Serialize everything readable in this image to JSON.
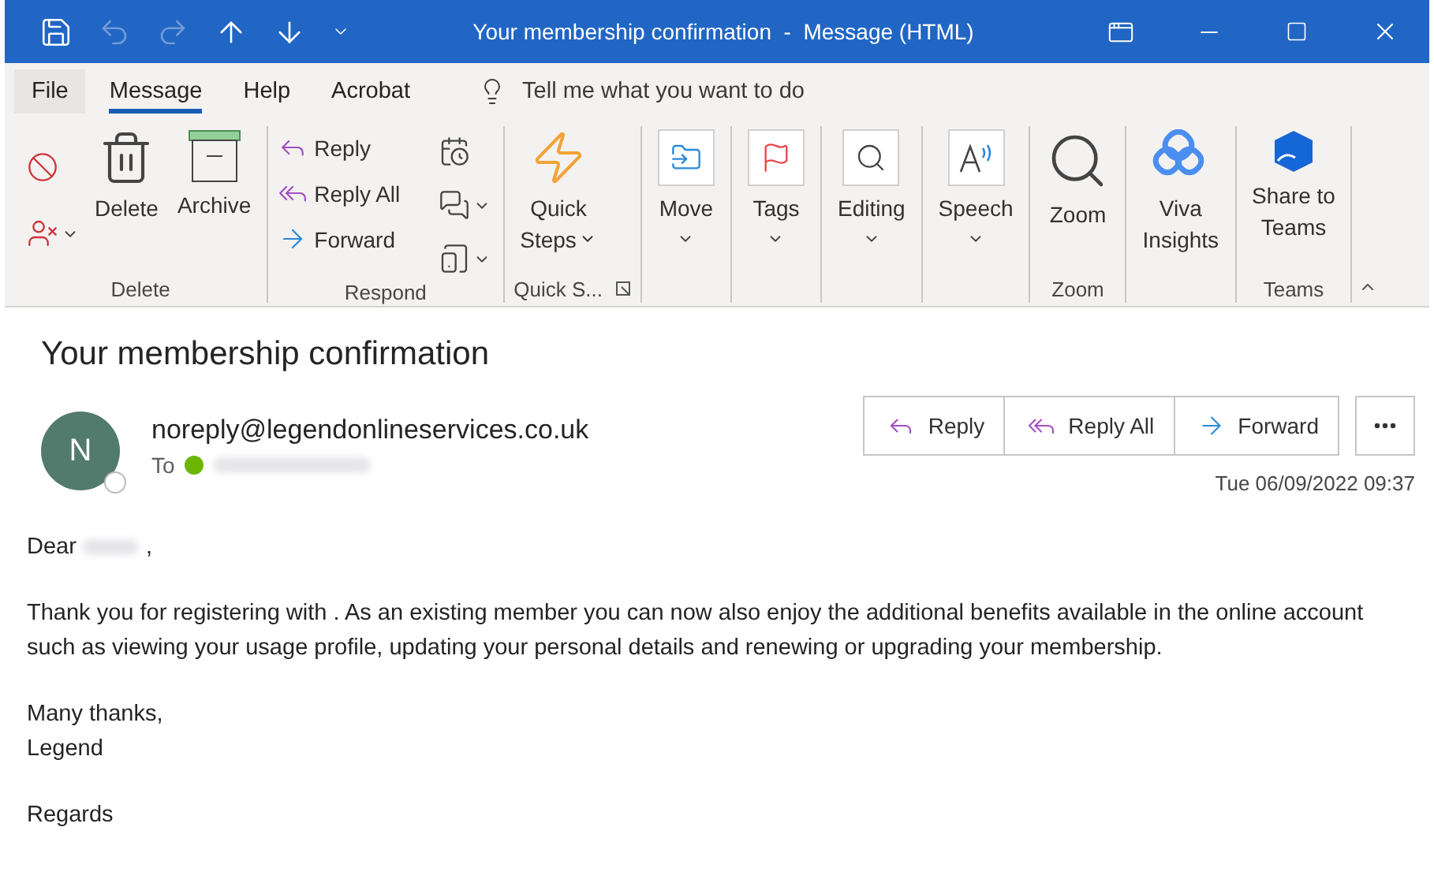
{
  "title_bar": {
    "title": "Your membership confirmation  -  Message (HTML)",
    "quick_access": [
      {
        "kind": "save",
        "disabled": false
      },
      {
        "kind": "undo",
        "disabled": true
      },
      {
        "kind": "redo",
        "disabled": true
      },
      {
        "kind": "up",
        "disabled": false
      },
      {
        "kind": "down",
        "disabled": false
      },
      {
        "kind": "customize",
        "disabled": false
      }
    ]
  },
  "tabs": [
    {
      "label": "File",
      "selected": false
    },
    {
      "label": "Message",
      "selected": true
    },
    {
      "label": "Help",
      "selected": false
    },
    {
      "label": "Acrobat",
      "selected": false
    }
  ],
  "tell_me": {
    "placeholder": "Tell me what you want to do"
  },
  "ribbon": [
    {
      "label": "Delete",
      "launcher": false,
      "commands": [
        {
          "kind": "icon",
          "dropdown": false
        },
        {
          "kind": "icon",
          "dropdown": true
        },
        {
          "kind": "large",
          "label": "Delete",
          "dropdown": false
        },
        {
          "kind": "large",
          "label": "Archive",
          "dropdown": false
        }
      ]
    },
    {
      "label": "Respond",
      "launcher": false,
      "commands": [
        {
          "kind": "small",
          "label": "Reply",
          "dropdown": false
        },
        {
          "kind": "small",
          "label": "Reply All",
          "dropdown": false
        },
        {
          "kind": "small",
          "label": "Forward",
          "dropdown": false
        },
        {
          "kind": "icon",
          "dropdown": false
        },
        {
          "kind": "icon",
          "dropdown": true
        },
        {
          "kind": "icon",
          "dropdown": true
        }
      ]
    },
    {
      "label": "Quick S...",
      "launcher": true,
      "commands": [
        {
          "kind": "large",
          "label": "Quick\nSteps",
          "dropdown": true
        }
      ]
    },
    {
      "launcher": false,
      "commands": [
        {
          "kind": "boxed",
          "label": "Move",
          "dropdown": true
        }
      ]
    },
    {
      "launcher": false,
      "commands": [
        {
          "kind": "boxed",
          "label": "Tags",
          "dropdown": true
        }
      ]
    },
    {
      "launcher": false,
      "commands": [
        {
          "kind": "boxed",
          "label": "Editing",
          "dropdown": true
        }
      ]
    },
    {
      "launcher": false,
      "commands": [
        {
          "kind": "boxed",
          "label": "Speech",
          "dropdown": true
        }
      ]
    },
    {
      "label": "Zoom",
      "launcher": false,
      "commands": [
        {
          "kind": "large",
          "label": "Zoom",
          "dropdown": false
        }
      ]
    },
    {
      "launcher": false,
      "commands": [
        {
          "kind": "large",
          "label": "Viva\nInsights",
          "dropdown": false
        }
      ]
    },
    {
      "label": "Teams",
      "launcher": false,
      "commands": [
        {
          "kind": "large",
          "label": "Share to\nTeams",
          "dropdown": false
        }
      ]
    }
  ],
  "message": {
    "subject": "Your membership confirmation",
    "avatar_initial": "N",
    "sender": "noreply@legendonlineservices.co.uk",
    "to_label": "To",
    "recipient_online": true,
    "actions": [
      {
        "kind": "reply",
        "label": "Reply"
      },
      {
        "kind": "reply_all",
        "label": "Reply All"
      },
      {
        "kind": "forward",
        "label": "Forward"
      }
    ],
    "date": "Tue 06/09/2022 09:37",
    "body": [
      {
        "kind": "greeting",
        "text": "Dear",
        "after": ","
      },
      {
        "kind": "para",
        "text": "Thank you for registering with . As an existing member you can now also enjoy the additional benefits available in the online account such as viewing your usage profile, updating your personal details and renewing or upgrading your membership."
      },
      {
        "kind": "lines",
        "lines": [
          "Many thanks,",
          "Legend"
        ]
      },
      {
        "kind": "para",
        "text": "Regards"
      }
    ]
  }
}
